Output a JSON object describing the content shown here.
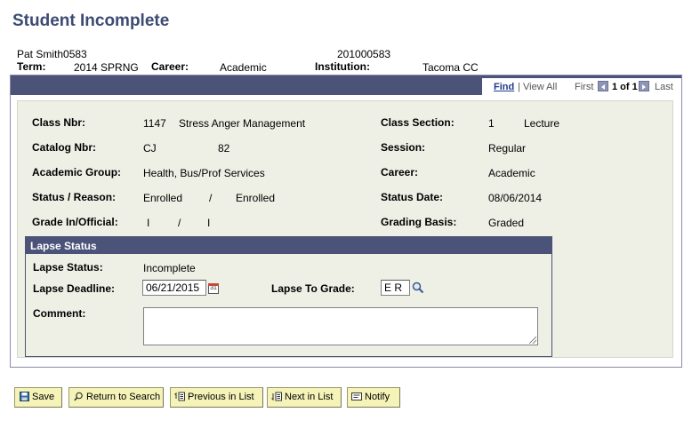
{
  "page": {
    "title": "Student Incomplete"
  },
  "header": {
    "student_name": "Pat Smith0583",
    "student_id": "201000583",
    "term_label": "Term:",
    "term_value": "2014 SPRNG",
    "career_label": "Career:",
    "career_value": "Academic",
    "institution_label": "Institution:",
    "institution_value": "Tacoma CC"
  },
  "nav": {
    "find": "Find",
    "separator": "|",
    "view_all": "View All",
    "first": "First",
    "count": "1 of 1",
    "last": "Last"
  },
  "details": {
    "class_nbr_label": "Class Nbr:",
    "class_nbr_value": "1147",
    "class_name": "Stress Anger Management",
    "class_section_label": "Class Section:",
    "class_section_value": "1",
    "class_section_type": "Lecture",
    "catalog_nbr_label": "Catalog Nbr:",
    "catalog_subject": "CJ",
    "catalog_number": "82",
    "session_label": "Session:",
    "session_value": "Regular",
    "academic_group_label": "Academic Group:",
    "academic_group_value": "Health, Bus/Prof Services",
    "career_label": "Career:",
    "career_value": "Academic",
    "status_reason_label": "Status / Reason:",
    "status_value": "Enrolled",
    "status_sep": "/",
    "reason_value": "Enrolled",
    "status_date_label": "Status Date:",
    "status_date_value": "08/06/2014",
    "grade_label": "Grade In/Official:",
    "grade_in": "I",
    "grade_sep": "/",
    "grade_official": "I",
    "grading_basis_label": "Grading Basis:",
    "grading_basis_value": "Graded"
  },
  "lapse": {
    "section_title": "Lapse Status",
    "status_label": "Lapse Status:",
    "status_value": "Incomplete",
    "deadline_label": "Lapse Deadline:",
    "deadline_value": "06/21/2015",
    "to_grade_label": "Lapse To Grade:",
    "to_grade_value": "E R",
    "comment_label": "Comment:",
    "comment_value": ""
  },
  "buttons": {
    "save": "Save",
    "return_to_search": "Return to Search",
    "previous_in_list": "Previous in List",
    "next_in_list": "Next in List",
    "notify": "Notify"
  }
}
